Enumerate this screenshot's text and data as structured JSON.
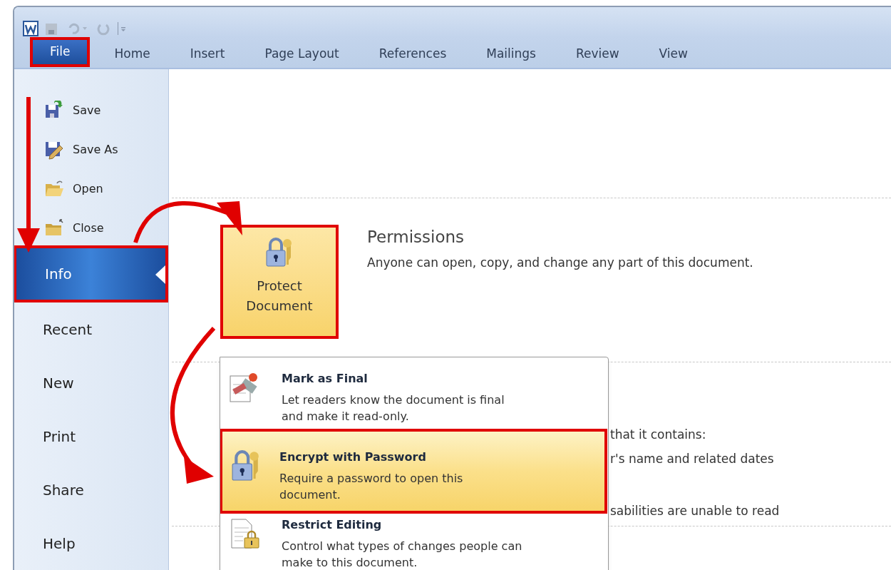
{
  "tabs": [
    {
      "label": "File",
      "selected": true,
      "annotated": true
    },
    {
      "label": "Home",
      "selected": false,
      "annotated": false
    },
    {
      "label": "Insert",
      "selected": false,
      "annotated": false
    },
    {
      "label": "Page Layout",
      "selected": false,
      "annotated": false
    },
    {
      "label": "References",
      "selected": false,
      "annotated": false
    },
    {
      "label": "Mailings",
      "selected": false,
      "annotated": false
    },
    {
      "label": "Review",
      "selected": false,
      "annotated": false
    },
    {
      "label": "View",
      "selected": false,
      "annotated": false
    }
  ],
  "backstage_menu": [
    {
      "kind": "command",
      "label": "Save",
      "selected": false,
      "annotated": false
    },
    {
      "kind": "command",
      "label": "Save As",
      "selected": false,
      "annotated": false
    },
    {
      "kind": "command",
      "label": "Open",
      "selected": false,
      "annotated": false
    },
    {
      "kind": "command",
      "label": "Close",
      "selected": false,
      "annotated": false
    },
    {
      "kind": "page",
      "label": "Info",
      "selected": true,
      "annotated": true
    },
    {
      "kind": "page",
      "label": "Recent",
      "selected": false,
      "annotated": false
    },
    {
      "kind": "page",
      "label": "New",
      "selected": false,
      "annotated": false
    },
    {
      "kind": "page",
      "label": "Print",
      "selected": false,
      "annotated": false
    },
    {
      "kind": "page",
      "label": "Share",
      "selected": false,
      "annotated": false
    },
    {
      "kind": "page",
      "label": "Help",
      "selected": false,
      "annotated": false
    }
  ],
  "protect_button": {
    "label": "Protect Document",
    "annotated": true
  },
  "permissions": {
    "title": "Permissions",
    "description": "Anyone can open, copy, and change any part of this document."
  },
  "background_texts": [
    "that it contains:",
    "r's name and related dates",
    "sabilities are unable to read"
  ],
  "protect_menu": [
    {
      "title": "Mark as Final",
      "description": "Let readers know the document is final and make it read-only.",
      "selected": false,
      "annotated": false
    },
    {
      "title": "Encrypt with Password",
      "description": "Require a password to open this document.",
      "selected": true,
      "annotated": true
    },
    {
      "title": "Restrict Editing",
      "description": "Control what types of changes people can make to this document.",
      "selected": false,
      "annotated": false
    }
  ]
}
